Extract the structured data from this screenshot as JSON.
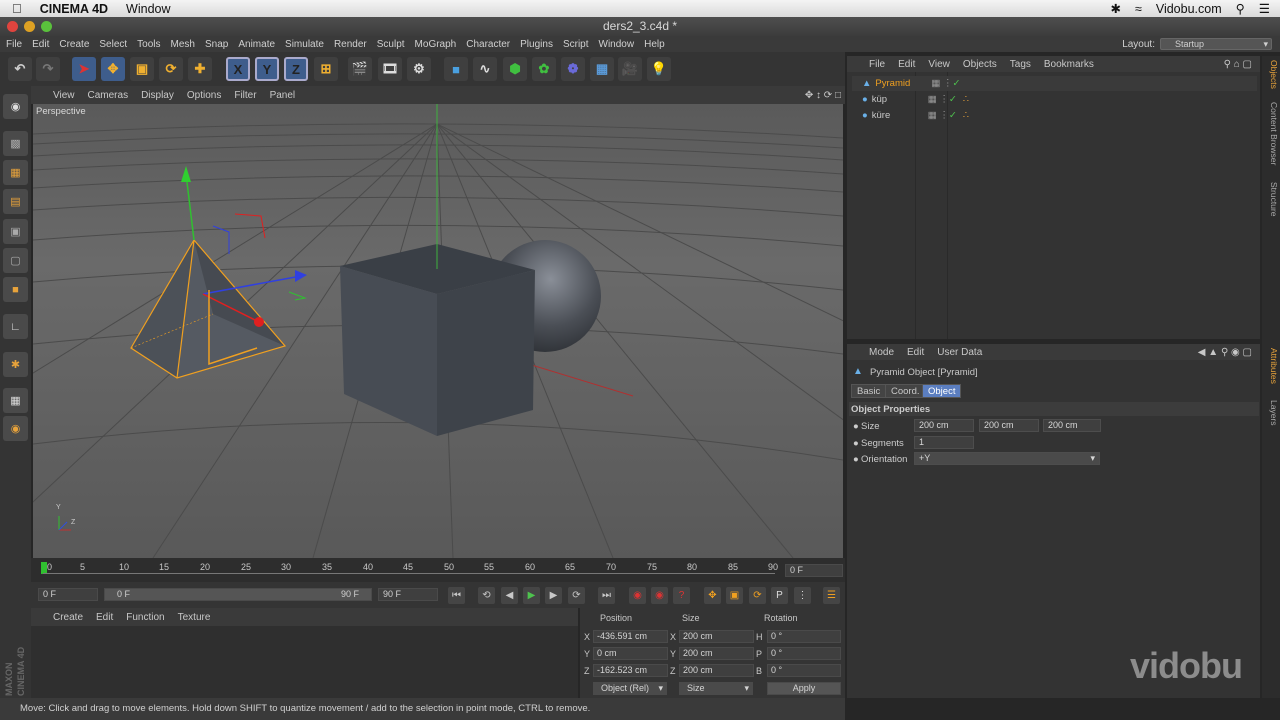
{
  "macbar": {
    "app": "CINEMA 4D",
    "menu": "Window",
    "site": "Vidobu.com"
  },
  "titlebar": {
    "title": "ders2_3.c4d *"
  },
  "mainmenu": {
    "items": [
      "File",
      "Edit",
      "Create",
      "Select",
      "Tools",
      "Mesh",
      "Snap",
      "Animate",
      "Simulate",
      "Render",
      "Sculpt",
      "MoGraph",
      "Character",
      "Plugins",
      "Script",
      "Window",
      "Help"
    ],
    "layout_label": "Layout:",
    "layout_value": "Startup"
  },
  "toolbar": {
    "x_label": "X",
    "y_label": "Y",
    "z_label": "Z"
  },
  "viewport": {
    "menu": [
      "View",
      "Cameras",
      "Display",
      "Options",
      "Filter",
      "Panel"
    ],
    "label": "Perspective",
    "axis_y": "Y",
    "axis_z": "Z"
  },
  "timeline": {
    "ticks": [
      "0",
      "5",
      "10",
      "15",
      "20",
      "25",
      "30",
      "35",
      "40",
      "45",
      "50",
      "55",
      "60",
      "65",
      "70",
      "75",
      "80",
      "85",
      "90"
    ],
    "current": "0 F",
    "start": "0 F",
    "range_start": "0 F",
    "range_end": "90 F",
    "end": "90 F"
  },
  "materials": {
    "menu": [
      "Create",
      "Edit",
      "Function",
      "Texture"
    ]
  },
  "coords": {
    "position_header": "Position",
    "size_header": "Size",
    "rotation_header": "Rotation",
    "rows": [
      {
        "axis": "X",
        "pos": "-436.591 cm",
        "saxis": "X",
        "size": "200 cm",
        "raxis": "H",
        "rot": "0 °"
      },
      {
        "axis": "Y",
        "pos": "0 cm",
        "saxis": "Y",
        "size": "200 cm",
        "raxis": "P",
        "rot": "0 °"
      },
      {
        "axis": "Z",
        "pos": "-162.523 cm",
        "saxis": "Z",
        "size": "200 cm",
        "raxis": "B",
        "rot": "0 °"
      }
    ],
    "mode": "Object (Rel)",
    "size_mode": "Size",
    "apply": "Apply"
  },
  "status": {
    "text": "Move: Click and drag to move elements. Hold down SHIFT to quantize movement / add to the selection in point mode, CTRL to remove."
  },
  "objects": {
    "menu": [
      "File",
      "Edit",
      "View",
      "Objects",
      "Tags",
      "Bookmarks"
    ],
    "items": [
      {
        "name": "Pyramid",
        "selected": true
      },
      {
        "name": "küp",
        "selected": false
      },
      {
        "name": "küre",
        "selected": false
      }
    ]
  },
  "attributes": {
    "menu": [
      "Mode",
      "Edit",
      "User Data"
    ],
    "title": "Pyramid Object [Pyramid]",
    "tabs": [
      "Basic",
      "Coord.",
      "Object"
    ],
    "active_tab": "Object",
    "section": "Object Properties",
    "size_label": "Size",
    "size_x": "200 cm",
    "size_y": "200 cm",
    "size_z": "200 cm",
    "segments_label": "Segments",
    "segments": "1",
    "orientation_label": "Orientation",
    "orientation": "+Y"
  },
  "sidetabs": [
    "Objects",
    "Content Browser",
    "Structure",
    "Attributes",
    "Layers"
  ],
  "watermark": "vidobu",
  "brand": "MAXON CINEMA 4D",
  "colors": {
    "accent": "#e8a33b",
    "selection": "#f0a020",
    "play": "#4ec24e",
    "active_tab": "#5b7ec0"
  }
}
